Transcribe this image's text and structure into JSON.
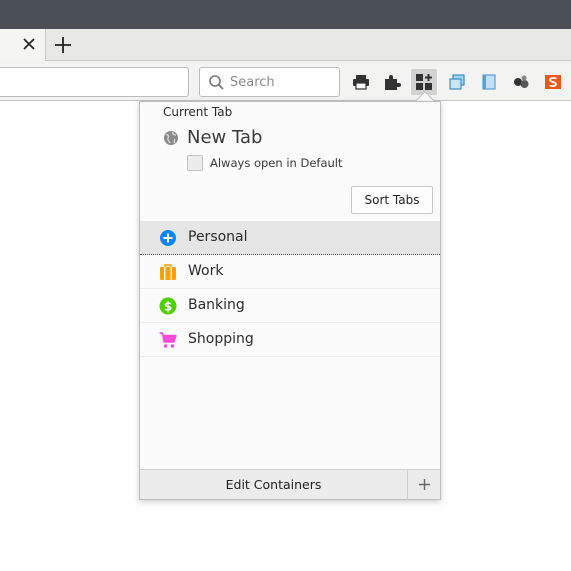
{
  "toolbar": {
    "search_placeholder": "Search"
  },
  "panel": {
    "current_tab_label": "Current Tab",
    "tab_title": "New Tab",
    "always_open_label": "Always open in Default",
    "sort_tabs_label": "Sort Tabs",
    "containers": [
      {
        "label": "Personal",
        "color": "#0a84ff",
        "icon": "fingerprint-plus-icon"
      },
      {
        "label": "Work",
        "color": "#ff9f00",
        "icon": "briefcase-icon"
      },
      {
        "label": "Banking",
        "color": "#51cd00",
        "icon": "dollar-icon"
      },
      {
        "label": "Shopping",
        "color": "#ff4bda",
        "icon": "cart-icon"
      }
    ],
    "edit_containers_label": "Edit Containers"
  }
}
